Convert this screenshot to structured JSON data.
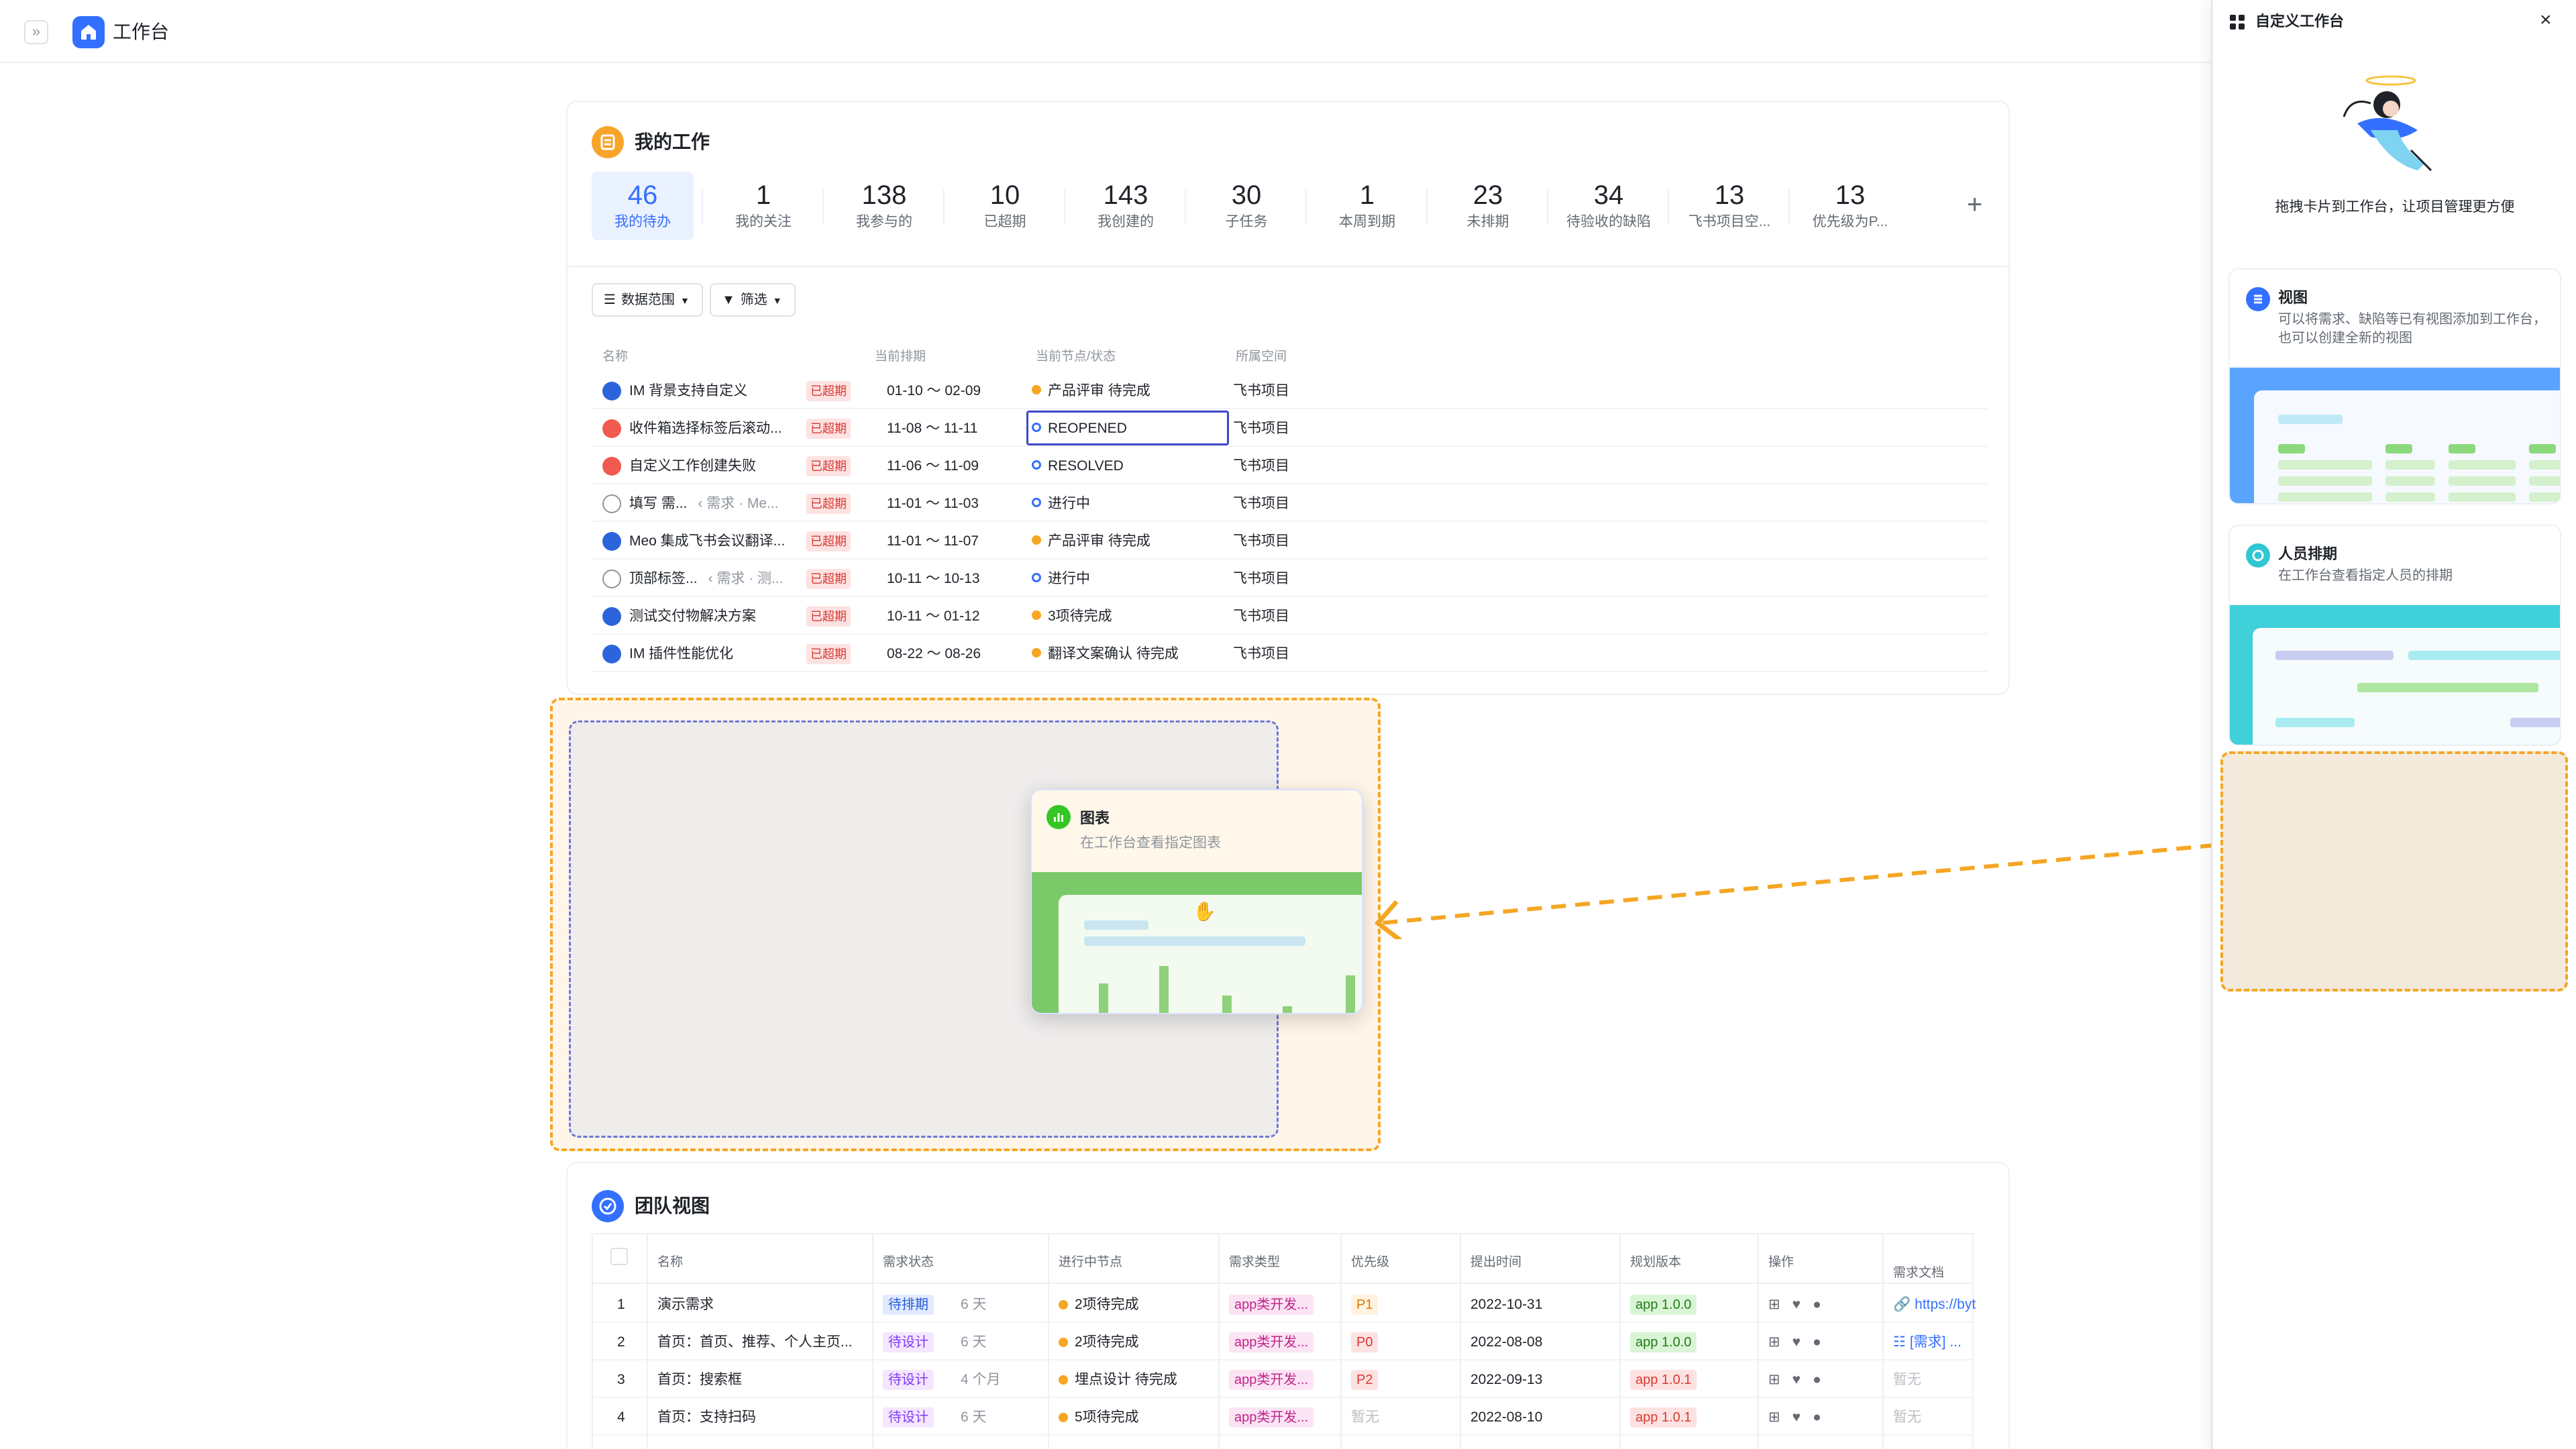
{
  "topbar": {
    "expand_glyph": "»",
    "title": "工作台"
  },
  "my_work": {
    "title": "我的工作",
    "stats": [
      {
        "num": "46",
        "label": "我的待办",
        "active": true
      },
      {
        "num": "1",
        "label": "我的关注"
      },
      {
        "num": "138",
        "label": "我参与的"
      },
      {
        "num": "10",
        "label": "已超期"
      },
      {
        "num": "143",
        "label": "我创建的"
      },
      {
        "num": "30",
        "label": "子任务"
      },
      {
        "num": "1",
        "label": "本周到期"
      },
      {
        "num": "23",
        "label": "未排期"
      },
      {
        "num": "34",
        "label": "待验收的缺陷"
      },
      {
        "num": "13",
        "label": "飞书项目空..."
      },
      {
        "num": "13",
        "label": "优先级为P..."
      }
    ],
    "add_glyph": "+",
    "filters": {
      "scope": "数据范围",
      "filter": "筛选"
    },
    "columns": {
      "name": "名称",
      "schedule": "当前排期",
      "node": "当前节点/状态",
      "space": "所属空间"
    },
    "rows": [
      {
        "icon": "blue",
        "name": "IM 背景支持自定义",
        "sub": "",
        "overdue": "已超期",
        "date": "01-10 ～ 02-09",
        "dot": "orange",
        "state": "产品评审 待完成",
        "space": "飞书项目"
      },
      {
        "icon": "red",
        "name": "收件箱选择标签后滚动...",
        "sub": "",
        "overdue": "已超期",
        "date": "11-08 ～ 11-11",
        "dot": "ring",
        "state": "REOPENED",
        "space": "飞书项目"
      },
      {
        "icon": "red",
        "name": "自定义工作创建失败",
        "sub": "",
        "overdue": "已超期",
        "date": "11-06 ～ 11-09",
        "dot": "ring",
        "state": "RESOLVED",
        "space": "飞书项目"
      },
      {
        "icon": "empty",
        "name": "填写 需...",
        "sub": "‹ 需求 · Me...",
        "overdue": "已超期",
        "date": "11-01 ～ 11-03",
        "dot": "ring",
        "state": "进行中",
        "space": "飞书项目"
      },
      {
        "icon": "blue",
        "name": "Meo 集成飞书会议翻译...",
        "sub": "",
        "overdue": "已超期",
        "date": "11-01 ～ 11-07",
        "dot": "orange",
        "state": "产品评审 待完成",
        "space": "飞书项目"
      },
      {
        "icon": "empty",
        "name": "顶部标签...",
        "sub": "‹ 需求 · 测...",
        "overdue": "已超期",
        "date": "10-11 ～ 10-13",
        "dot": "ring",
        "state": "进行中",
        "space": "飞书项目"
      },
      {
        "icon": "blue",
        "name": "测试交付物解决方案",
        "sub": "",
        "overdue": "已超期",
        "date": "10-11 ～ 01-12",
        "dot": "orange",
        "state": "3项待完成",
        "space": "飞书项目"
      },
      {
        "icon": "blue",
        "name": "IM 插件性能优化",
        "sub": "",
        "overdue": "已超期",
        "date": "08-22 ～ 08-26",
        "dot": "orange",
        "state": "翻译文案确认 待完成",
        "space": "飞书项目"
      }
    ]
  },
  "drag_card": {
    "title": "图表",
    "desc": "在工作台查看指定图表"
  },
  "team": {
    "title": "团队视图",
    "columns": [
      "名称",
      "需求状态",
      "进行中节点",
      "需求类型",
      "优先级",
      "提出时间",
      "规划版本",
      "操作",
      "需求文档"
    ],
    "rows": [
      {
        "idx": "1",
        "name": "演示需求",
        "status": "待排期",
        "status_tag": "blue",
        "dur": "6 天",
        "node": "2项待完成",
        "type": "app类开发...",
        "priority": "P1",
        "ptag": "p1",
        "date": "2022-10-31",
        "version": "app 1.0.0",
        "vtag": "ver",
        "doc": "https://byt",
        "doc_kind": "link"
      },
      {
        "idx": "2",
        "name": "首页：首页、推荐、个人主页...",
        "status": "待设计",
        "status_tag": "purple",
        "dur": "6 天",
        "node": "2项待完成",
        "type": "app类开发...",
        "priority": "P0",
        "ptag": "p0",
        "date": "2022-08-08",
        "version": "app 1.0.0",
        "vtag": "ver",
        "doc": "[需求] ...",
        "doc_kind": "link"
      },
      {
        "idx": "3",
        "name": "首页：搜索框",
        "status": "待设计",
        "status_tag": "purple",
        "dur": "4 个月",
        "node": "埋点设计 待完成",
        "type": "app类开发...",
        "priority": "P2",
        "ptag": "p2",
        "date": "2022-09-13",
        "version": "app 1.0.1",
        "vtag": "ver2",
        "doc": "暂无",
        "doc_kind": "muted"
      },
      {
        "idx": "4",
        "name": "首页：支持扫码",
        "status": "待设计",
        "status_tag": "purple",
        "dur": "6 天",
        "node": "5项待完成",
        "type": "app类开发...",
        "priority": "暂无",
        "ptag": "none",
        "date": "2022-08-10",
        "version": "app 1.0.1",
        "vtag": "ver2",
        "doc": "暂无",
        "doc_kind": "muted"
      }
    ]
  },
  "panel": {
    "title": "自定义工作台",
    "close_glyph": "×",
    "hint": "拖拽卡片到工作台，让项目管理更方便",
    "cards": [
      {
        "title": "视图",
        "desc": "可以将需求、缺陷等已有视图添加到工作台，也可以创建全新的视图"
      },
      {
        "title": "人员排期",
        "desc": "在工作台查看指定人员的排期"
      }
    ]
  }
}
